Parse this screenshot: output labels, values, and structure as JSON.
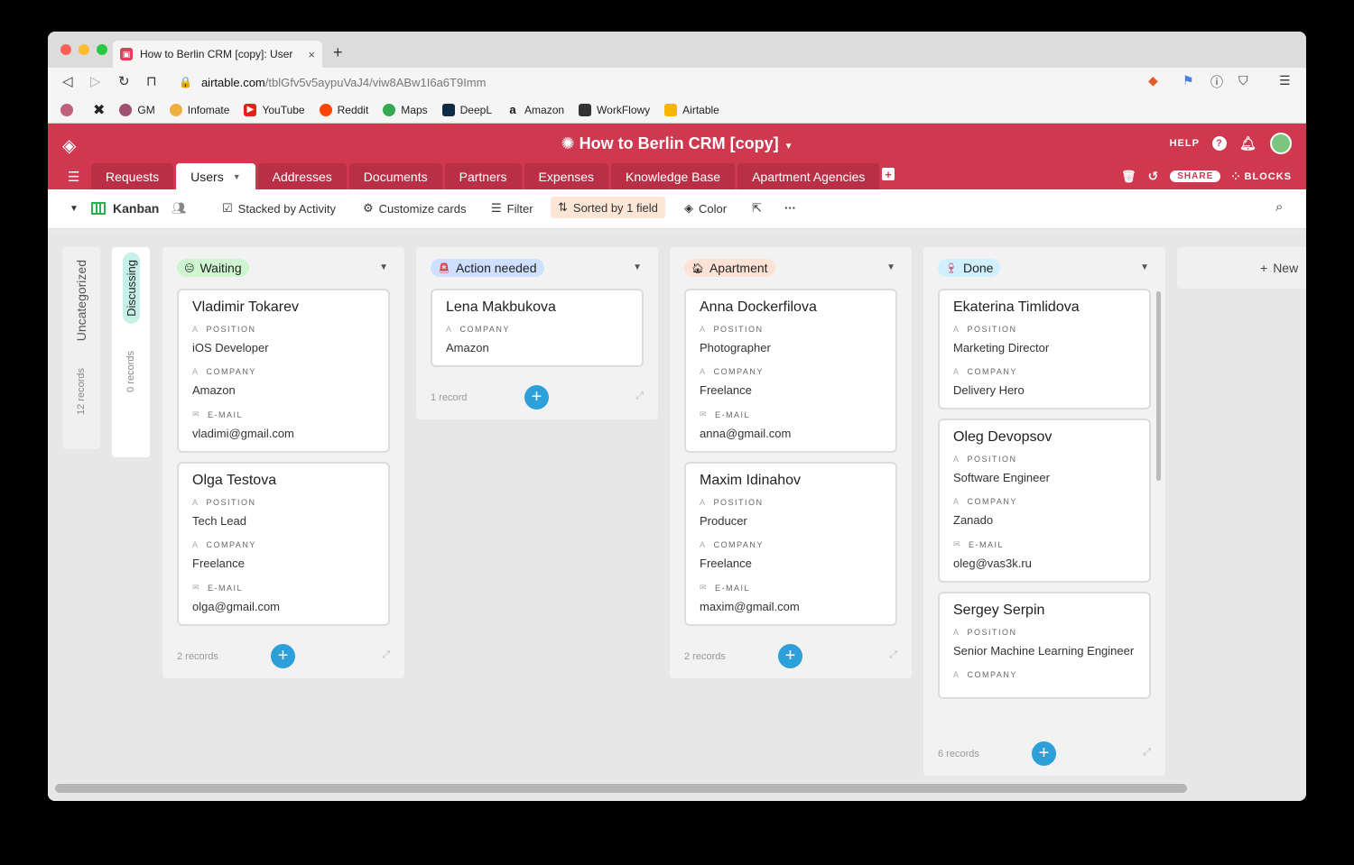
{
  "browser": {
    "tab_title": "How to Berlin CRM [copy]: User",
    "tab_close": "×",
    "new_tab": "+",
    "url_host": "airtable.com",
    "url_path": "/tblGfv5v5aypuVaJ4/viw8ABw1I6a6T9Imm",
    "bookmarks": [
      "GM",
      "Infomate",
      "YouTube",
      "Reddit",
      "Maps",
      "DeepL",
      "Amazon",
      "WorkFlowy",
      "Airtable"
    ]
  },
  "header": {
    "base_title": "How to Berlin CRM [copy]",
    "help_label": "HELP",
    "share_label": "SHARE",
    "blocks_label": "BLOCKS"
  },
  "tables": [
    "Requests",
    "Users",
    "Addresses",
    "Documents",
    "Partners",
    "Expenses",
    "Knowledge Base",
    "Apartment Agencies"
  ],
  "viewbar": {
    "view_name": "Kanban",
    "stacked": "Stacked by Activity",
    "customize": "Customize cards",
    "filter": "Filter",
    "sorted": "Sorted by 1 field",
    "color": "Color",
    "more": "···"
  },
  "board": {
    "uncategorized": {
      "label": "Uncategorized",
      "count": "12 records"
    },
    "discussing": {
      "label": "Discussing",
      "count": "0 records"
    },
    "new_stack": "New",
    "labels": {
      "position": "POSITION",
      "company": "COMPANY",
      "email": "E-MAIL"
    },
    "columns": [
      {
        "title": "Waiting",
        "count": "2 records",
        "cards": [
          {
            "name": "Vladimir Tokarev",
            "position": "iOS Developer",
            "company": "Amazon",
            "email": "vladimi@gmail.com"
          },
          {
            "name": "Olga Testova",
            "position": "Tech Lead",
            "company": "Freelance",
            "email": "olga@gmail.com"
          }
        ]
      },
      {
        "title": "Action needed",
        "count": "1 record",
        "cards": [
          {
            "name": "Lena Makbukova",
            "company": "Amazon"
          }
        ]
      },
      {
        "title": "Apartment",
        "count": "2 records",
        "cards": [
          {
            "name": "Anna Dockerfilova",
            "position": "Photographer",
            "company": "Freelance",
            "email": "anna@gmail.com"
          },
          {
            "name": "Maxim Idinahov",
            "position": "Producer",
            "company": "Freelance",
            "email": "maxim@gmail.com"
          }
        ]
      },
      {
        "title": "Done",
        "count": "6 records",
        "cards": [
          {
            "name": "Ekaterina Timlidova",
            "position": "Marketing Director",
            "company": "Delivery Hero"
          },
          {
            "name": "Oleg Devopsov",
            "position": "Software Engineer",
            "company": "Zanado",
            "email": "oleg@vas3k.ru"
          },
          {
            "name": "Sergey Serpin",
            "position": "Senior Machine Learning Engineer"
          }
        ]
      }
    ]
  },
  "colors": {
    "brand": "#d0384f",
    "waiting_pill": "#cff5d1",
    "action_pill": "#cfdffe",
    "apartment_pill": "#fee2d5",
    "done_pill": "#d0f0fd",
    "add_button": "#2d9fd9"
  }
}
